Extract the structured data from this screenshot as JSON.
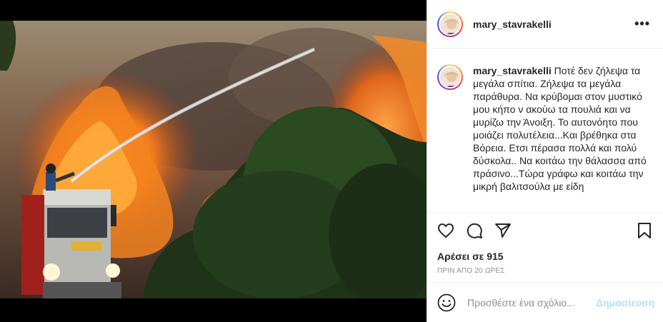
{
  "post": {
    "username": "mary_stavrakelli",
    "caption": "Ποτέ δεν ζήλεψα τα μεγάλα σπίτια. Ζήλεψα τα μεγάλα παράθυρα. Να κρύβομαι στον μυστικό μου κήπο ν ακούω τα πουλιά και να μυρίζω την Άνοιξη. Το αυτονόητο που μοιάζει πολυτέλεια...Και βρέθηκα στα Βόρεια. Ετσι πέρασα πολλά και πολύ δύσκολα.. Να κοιτάω την θάλασσα από πράσινο...Τώρα γράφω και κοιτάω την μικρή βαλιτσούλα με είδη",
    "likes": "Αρέσει σε 915",
    "timestamp": "ΠΡΙΝ ΑΠΟ 20 ΩΡΕΣ"
  },
  "header": {
    "more_label": "•••"
  },
  "comment": {
    "placeholder": "Προσθέστε ένα σχόλιο...",
    "post_label": "Δημοσίευση"
  },
  "icons": {
    "like": "heart-icon",
    "comment": "comment-icon",
    "share": "paper-plane-icon",
    "save": "bookmark-icon",
    "emoji": "smiley-icon"
  },
  "colors": {
    "post_button": "#b2dffc",
    "secondary_text": "#8e8e8e"
  }
}
